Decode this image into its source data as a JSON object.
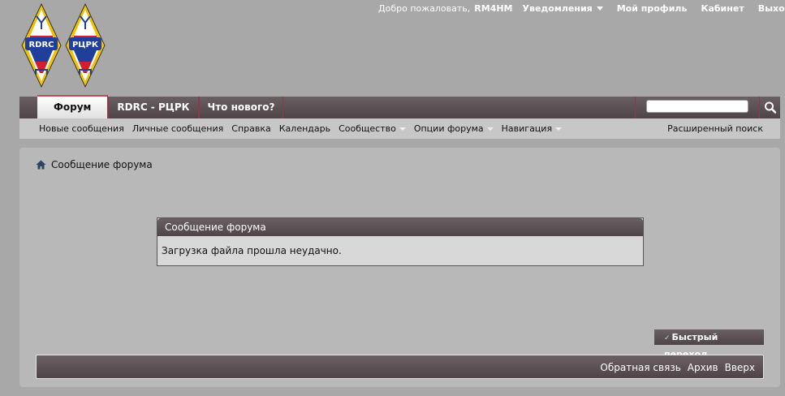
{
  "logos": [
    {
      "name": "rdrc-logo",
      "text": "RDRC"
    },
    {
      "name": "rtsrk-logo",
      "text": "РЦРК"
    }
  ],
  "userbar": {
    "welcome": "Добро пожаловать,",
    "username": "RM4HM",
    "notifications": "Уведомления",
    "profile": "Мой профиль",
    "cabinet": "Кабинет",
    "logout": "Выход"
  },
  "tabs": [
    {
      "label": "Форум",
      "active": true
    },
    {
      "label": "RDRC - РЦРК",
      "active": false
    },
    {
      "label": "Что нового?",
      "active": false
    }
  ],
  "search": {
    "placeholder": ""
  },
  "subnav": {
    "items": [
      "Новые сообщения",
      "Личные сообщения",
      "Справка",
      "Календарь",
      "Сообщество",
      "Опции форума",
      "Навигация"
    ],
    "advanced_search": "Расширенный поиск"
  },
  "breadcrumb": {
    "current": "Сообщение форума"
  },
  "message": {
    "title": "Сообщение форума",
    "body": "Загрузка файла прошла неудачно."
  },
  "quick_nav": {
    "label": "Быстрый переход"
  },
  "footer": {
    "links": [
      "Обратная связь",
      "Архив",
      "Вверх"
    ]
  },
  "colors": {
    "bar": "#5c5255",
    "accent": "#c7485c",
    "background": "#a8a8a8",
    "panel": "#b8b8b8"
  }
}
